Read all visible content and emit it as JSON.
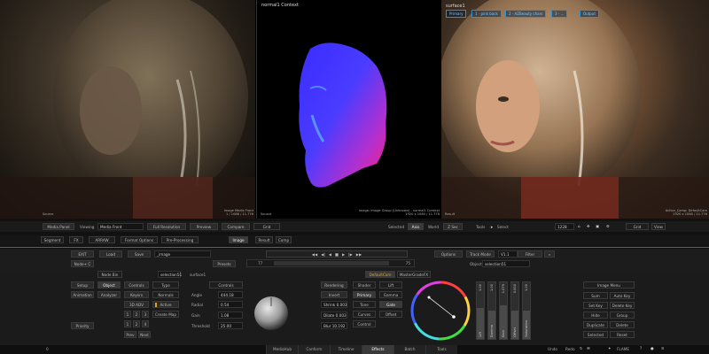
{
  "viewers": {
    "left": {
      "bottom_label": "Source",
      "info": [
        "Image Media Front",
        "1 / 1088 / 11.776"
      ]
    },
    "mid": {
      "title": "normal1 Context",
      "bottom_label": "Source",
      "info": [
        "Image: Image Group (Unknown) - normal1 Context",
        "1920 x 1080 / 11.776"
      ]
    },
    "right": {
      "title": "surface1",
      "tags": [
        "Primary",
        "1 - pink back",
        "2 - AZBeauty chars",
        "3 - ...",
        "Output"
      ],
      "bottom_label": "Result",
      "info": [
        "Action_Comp: DefaultCam",
        "1920 x 1080 / 11.776"
      ]
    }
  },
  "viewer_bar": {
    "media_panel": "Media Panel",
    "viewing_label": "Viewing",
    "viewing_value": "Media Front",
    "full_resolution": "Full Resolution",
    "preview": "Preview",
    "compare": "Compare",
    "grid": "Grid",
    "selected": "Selected",
    "axis": "Axis",
    "world": "World",
    "z_sec": "Z Sec",
    "tools": "Tools",
    "select": "Select",
    "zoom": "1228",
    "grid2": "Grid",
    "view": "View"
  },
  "tool_row": {
    "segment": "Segment",
    "fx": "FX",
    "arrow": "ARRAW",
    "format_options": "Format Options",
    "pre_processing": "Pre-Processing",
    "image": "Image",
    "result": "Result",
    "comp": "Comp"
  },
  "toolbar2": {
    "exit": "EXIT",
    "load": "Load",
    "save": "Save",
    "setup_name": "_image",
    "node_c": "Node+ C",
    "presets": "Presets",
    "frame_start": "77",
    "frame_end": "75",
    "options": "Options",
    "track_mode": "Track Mode",
    "track_version": "V1.1",
    "filter": "Filter",
    "object": "Object",
    "object_value": "selection51"
  },
  "left_panel": {
    "node_bin": "Node Bin",
    "node_field": "selection51",
    "setup": "Setup",
    "object": "Object",
    "controls": "Controls",
    "type": "Type",
    "animation": "Animation",
    "analyzer": "Analyzer",
    "keyers": "Keyers",
    "normals": "Normals",
    "mode_3d": "3D ADV",
    "active": "Active",
    "create_map": "Create Map",
    "n1": "1",
    "n2": "2",
    "n3": "3",
    "n4": "4",
    "priority": "Priority",
    "prev": "Prev",
    "next": "Next"
  },
  "mid_panel": {
    "title": "surface1",
    "controls": "Controls",
    "angle_label": "Angle",
    "angle_value": "444.18",
    "radial_label": "Radial",
    "radial_value": "0.54",
    "gain_label": "Gain",
    "gain_value": "1.08",
    "threshold_label": "Threshold",
    "threshold_value": "25.00"
  },
  "render_panel": {
    "rendering": "Rendering",
    "invert": "Invert",
    "shrink": "Shrink 0.003",
    "dilate": "Dilate 0.003",
    "blur": "Blur 10.192"
  },
  "grade_panel": {
    "default_cam": "DefaultCam",
    "master_grade": "MasterGradeFX",
    "shader": "Shader",
    "lift": "Lift",
    "primary": "Primary",
    "gamma": "Gamma",
    "tone": "Tone",
    "gate": "Gate",
    "curves": "Curves",
    "offset": "Offset",
    "control": "Control"
  },
  "sliders": [
    {
      "label": "Lift",
      "value": "1.00",
      "fill": 0.55
    },
    {
      "label": "Gamma",
      "value": "1.00",
      "fill": 0.5
    },
    {
      "label": "Gain",
      "value": "1.079",
      "fill": 0.6
    },
    {
      "label": "Offset",
      "value": "0.000",
      "fill": 0.5
    },
    {
      "label": "Saturation",
      "value": "1.00",
      "fill": 0.5
    }
  ],
  "right_panel": {
    "image_menu": "Image Menu",
    "sum": "Sum",
    "auto_key": "Auto Key",
    "set_key": "Set Key",
    "delete_key": "Delete Key",
    "hide": "Hide",
    "group": "Group",
    "duplicate": "Duplicate",
    "delete": "Delete",
    "selected": "Selected",
    "reset": "Reset"
  },
  "bottom_tabs": [
    "MediaHub",
    "Conform",
    "Timeline",
    "Effects",
    "Batch",
    "Tools"
  ],
  "bottom_bar": {
    "timecode": "0",
    "undo": "Undo",
    "redo": "Redo",
    "brand": "FLAME"
  },
  "colors": {
    "accent_blue": "#2e6aa3",
    "active_orange": "#e0a020"
  }
}
